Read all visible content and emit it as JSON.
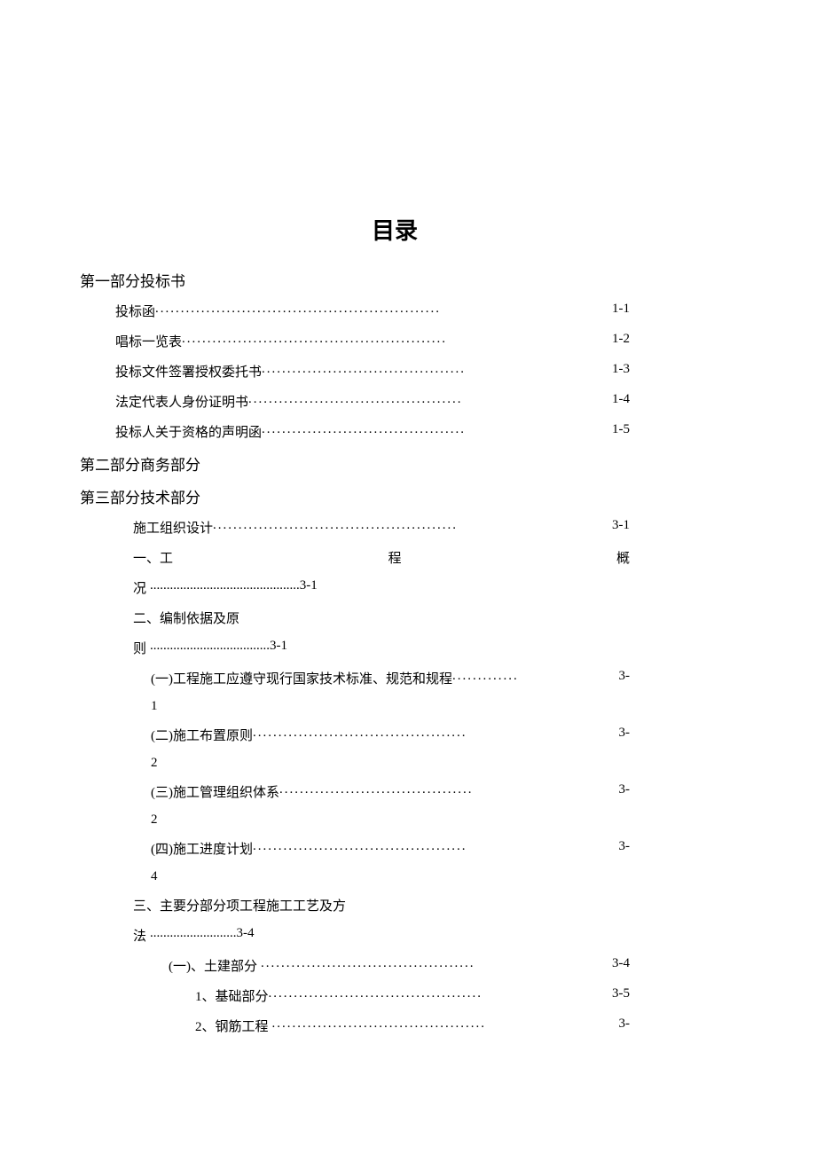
{
  "title": "目录",
  "sections": {
    "part1": {
      "heading": "第一部分投标书"
    },
    "part2": {
      "heading": "第二部分商务部分"
    },
    "part3": {
      "heading": "第三部分技术部分"
    }
  },
  "toc": {
    "e1": {
      "label": "投标函",
      "dots": "........................................................",
      "page": "1-1"
    },
    "e2": {
      "label": "唱标一览表",
      "dots": "....................................................",
      "page": "1-2"
    },
    "e3": {
      "label": "投标文件签署授权委托书",
      "dots": "........................................",
      "page": "1-3"
    },
    "e4": {
      "label": "法定代表人身份证明书",
      "dots": "..........................................",
      "page": "1-4"
    },
    "e5": {
      "label": "投标人关于资格的声明函",
      "dots": "........................................",
      "page": "1-5"
    },
    "e6": {
      "label": "施工组织设计",
      "dots": "................................................",
      "page": "3-1"
    },
    "e7": {
      "c1": "一、工",
      "c2": "程",
      "c3": "概",
      "tail": "况",
      "dots": ".............................................",
      "page": "3-1"
    },
    "e8": {
      "label": "二、编制依据及原",
      "tail": "则",
      "dots": "....................................",
      "page": "3-1"
    },
    "e9": {
      "label": "(一)工程施工应遵守现行国家技术标准、规范和规程",
      "dots": ".............",
      "page": "3-",
      "pageline": "1"
    },
    "e10": {
      "label": "(二)施工布置原则",
      "dots": "..........................................",
      "page": "3-",
      "pageline": "2"
    },
    "e11": {
      "label": "(三)施工管理组织体系",
      "dots": "......................................",
      "page": "3-",
      "pageline": "2"
    },
    "e12": {
      "label": "(四)施工进度计划",
      "dots": "..........................................",
      "page": "3-",
      "pageline": "4"
    },
    "e13": {
      "label": "三、主要分部分项工程施工工艺及方",
      "tail": "法",
      "dots": "..........................",
      "page": "3-4"
    },
    "e14": {
      "label": "(一)、土建部分",
      "dots": "..........................................",
      "page": "3-4"
    },
    "e15": {
      "label": "1、基础部分",
      "dots": "..........................................",
      "page": "3-5"
    },
    "e16": {
      "label": "2、钢筋工程",
      "dots": "..........................................",
      "page": "3-"
    }
  }
}
